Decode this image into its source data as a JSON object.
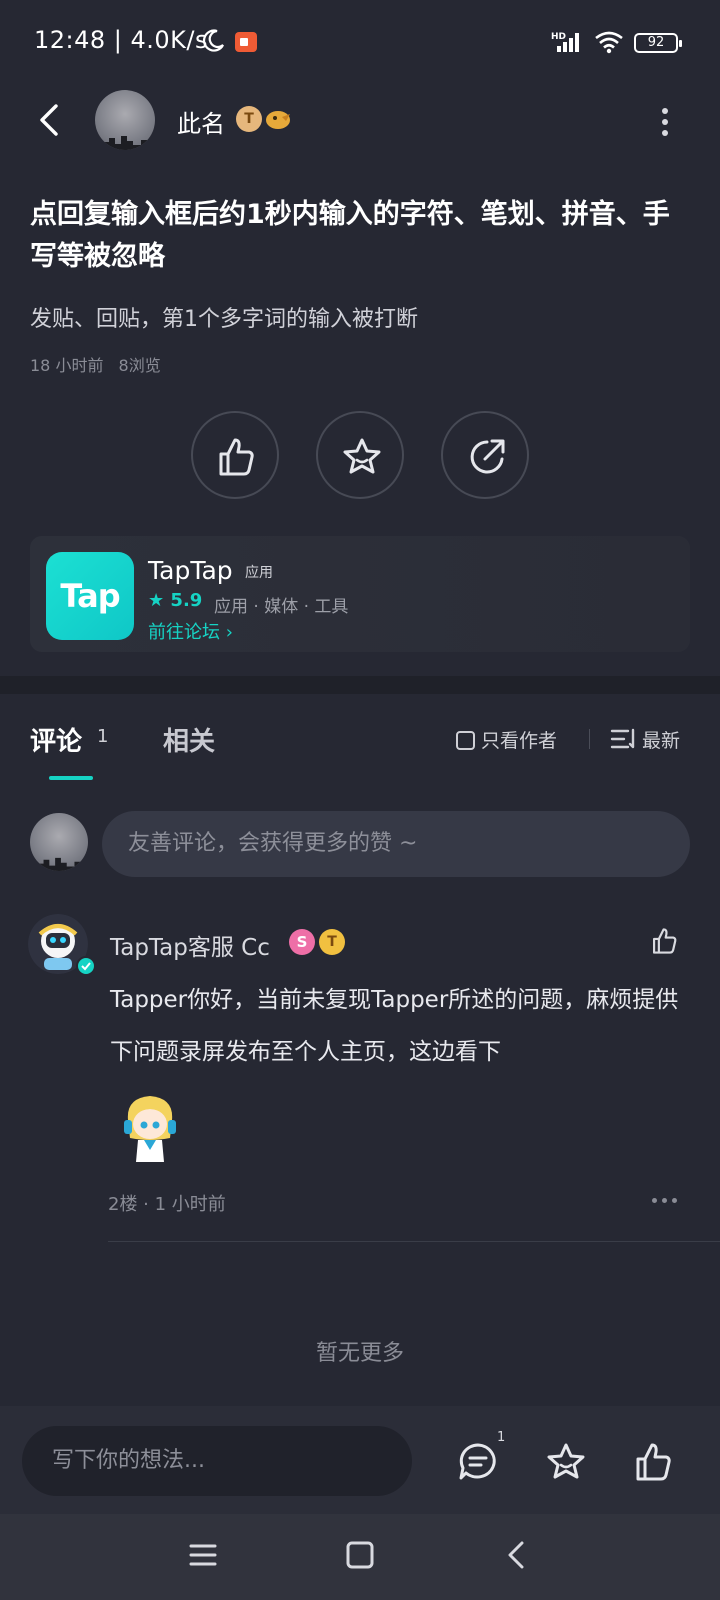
{
  "status_bar": {
    "time": "12:48",
    "speed": "4.0K/s",
    "battery": "92",
    "network_label": "HD"
  },
  "header": {
    "author_name": "此名",
    "badge_t": "T"
  },
  "post": {
    "title": "点回复输入框后约1秒内输入的字符、笔划、拼音、手写等被忽略",
    "body": "发贴、回贴，第1个多字词的输入被打断",
    "time": "18 小时前",
    "views": "8浏览"
  },
  "app_card": {
    "icon_text": "Tap",
    "name": "TapTap",
    "tag": "应用",
    "rating": "5.9",
    "categories": "应用 · 媒体 · 工具",
    "link": "前往论坛"
  },
  "tabs": {
    "comment_label": "评论",
    "comment_count": "1",
    "related_label": "相关",
    "author_only": "只看作者",
    "sort": "最新"
  },
  "comment_input": {
    "placeholder": "友善评论，会获得更多的赞 ~"
  },
  "comment": {
    "user": "TapTap客服 Cc",
    "badge_s": "S",
    "badge_t": "T",
    "text": "Tapper你好，当前未复现Tapper所述的问题，麻烦提供下问题录屏发布至个人主页，这边看下",
    "floor": "2楼",
    "time": "1 小时前"
  },
  "footer": {
    "no_more": "暂无更多"
  },
  "bottom_bar": {
    "placeholder": "写下你的想法...",
    "comment_count": "1"
  },
  "colors": {
    "accent": "#16d3c4",
    "background": "#262833"
  }
}
